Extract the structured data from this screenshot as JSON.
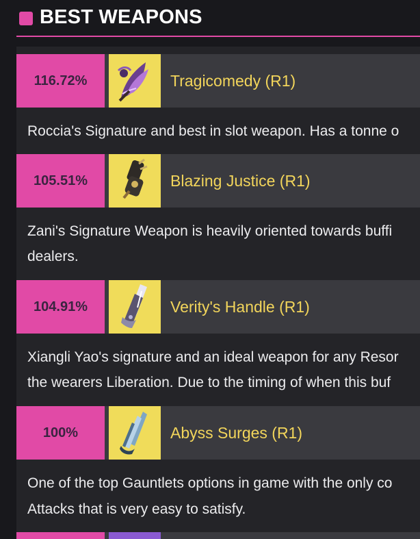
{
  "header": {
    "title": "BEST WEAPONS"
  },
  "weapons": [
    {
      "score": "116.72%",
      "name": "Tragicomedy (R1)",
      "description": [
        "Roccia's Signature and best in slot weapon. Has a tonne o"
      ]
    },
    {
      "score": "105.51%",
      "name": "Blazing Justice (R1)",
      "description": [
        "Zani's Signature Weapon is heavily oriented towards buffi",
        "dealers."
      ]
    },
    {
      "score": "104.91%",
      "name": "Verity's Handle (R1)",
      "description": [
        "Xiangli Yao's signature and an ideal weapon for any Resor",
        "the wearers Liberation. Due to the timing of when this buf"
      ]
    },
    {
      "score": "100%",
      "name": "Abyss Surges (R1)",
      "description": [
        "One of the top Gauntlets options in game with the only co",
        "Attacks that is very easy to satisfy."
      ]
    }
  ],
  "colors": {
    "accent": "#e14aa6",
    "weapon_name": "#f2d55b",
    "thumb_bg": "#f0dc5a",
    "background": "#18181c",
    "panel": "#242428"
  }
}
